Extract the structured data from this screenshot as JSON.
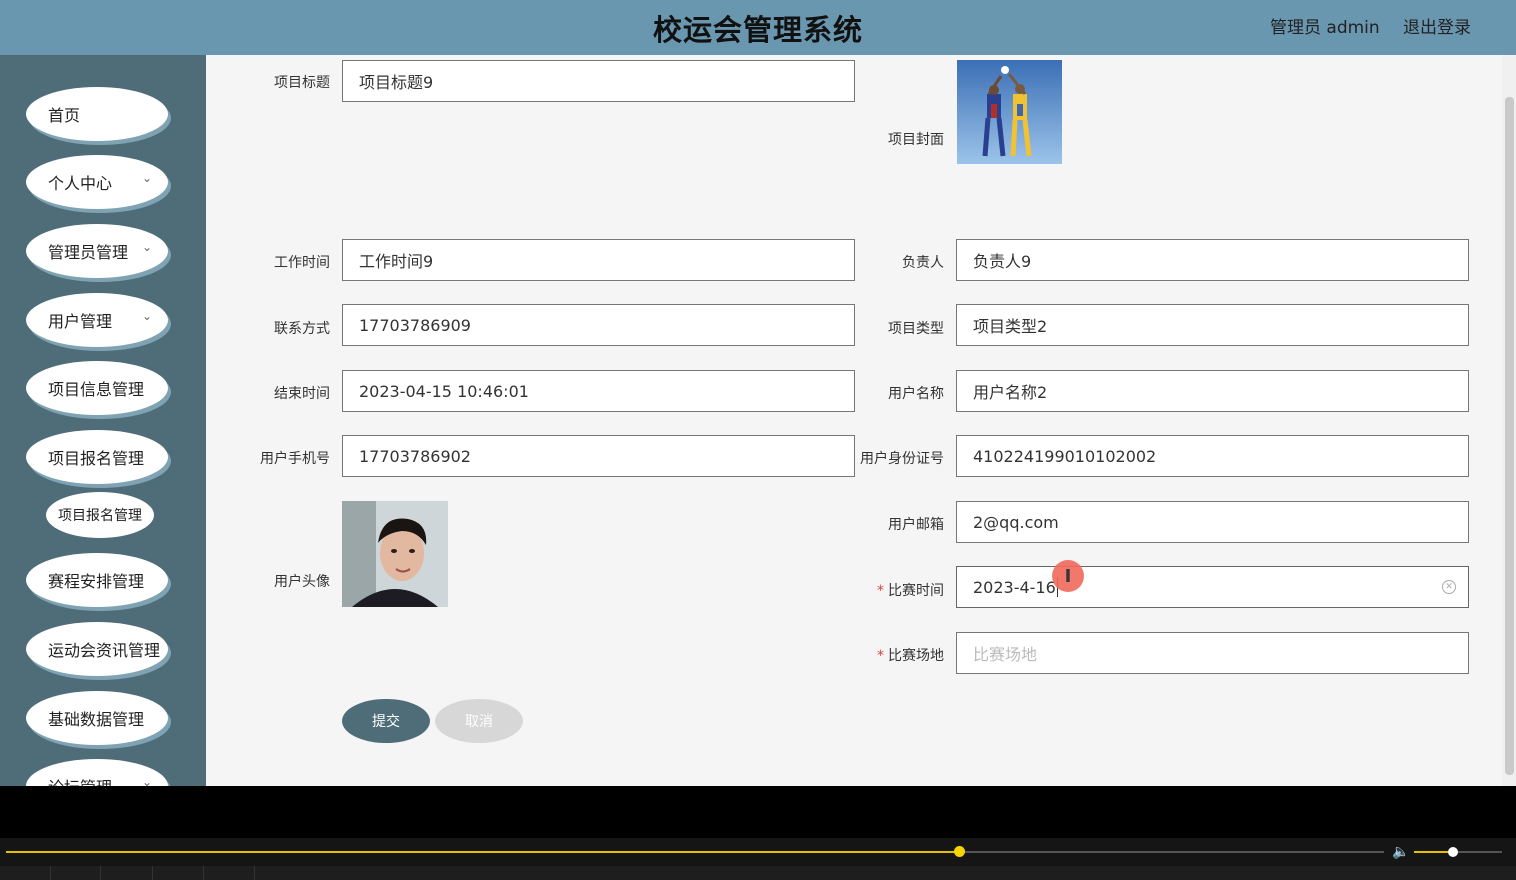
{
  "header": {
    "title": "校运会管理系统",
    "user": "管理员 admin",
    "logout": "退出登录"
  },
  "sidebar": {
    "items": [
      {
        "label": "首页",
        "chevron": ""
      },
      {
        "label": "个人中心",
        "chevron": "⌄"
      },
      {
        "label": "管理员管理",
        "chevron": "⌄"
      },
      {
        "label": "用户管理",
        "chevron": "⌄"
      },
      {
        "label": "项目信息管理",
        "chevron": ""
      },
      {
        "label": "项目报名管理",
        "chevron": ""
      },
      {
        "label": "赛程安排管理",
        "chevron": ""
      },
      {
        "label": "运动会资讯管理",
        "chevron": ""
      },
      {
        "label": "基础数据管理",
        "chevron": ""
      },
      {
        "label": "论坛管理",
        "chevron": "⌄"
      }
    ],
    "sub_item": "项目报名管理"
  },
  "form": {
    "title": {
      "label": "项目标题",
      "value": "项目标题9"
    },
    "cover": {
      "label": "项目封面"
    },
    "work_time": {
      "label": "工作时间",
      "value": "工作时间9"
    },
    "manager": {
      "label": "负责人",
      "value": "负责人9"
    },
    "contact": {
      "label": "联系方式",
      "value": "17703786909"
    },
    "type": {
      "label": "项目类型",
      "value": "项目类型2"
    },
    "end_time": {
      "label": "结束时间",
      "value": "2023-04-15 10:46:01"
    },
    "user_name": {
      "label": "用户名称",
      "value": "用户名称2"
    },
    "user_phone": {
      "label": "用户手机号",
      "value": "17703786902"
    },
    "user_id": {
      "label": "用户身份证号",
      "value": "410224199010102002"
    },
    "user_email": {
      "label": "用户邮箱",
      "value": "2@qq.com"
    },
    "avatar": {
      "label": "用户头像"
    },
    "match_time": {
      "label": "比赛时间",
      "value": "2023-4-16",
      "required": "*"
    },
    "match_venue": {
      "label": "比赛场地",
      "placeholder": "比赛场地",
      "required": "*"
    },
    "submit": "提交",
    "cancel": "取消"
  },
  "player": {
    "progress_fraction": 0.69,
    "volume_fraction": 0.44
  }
}
